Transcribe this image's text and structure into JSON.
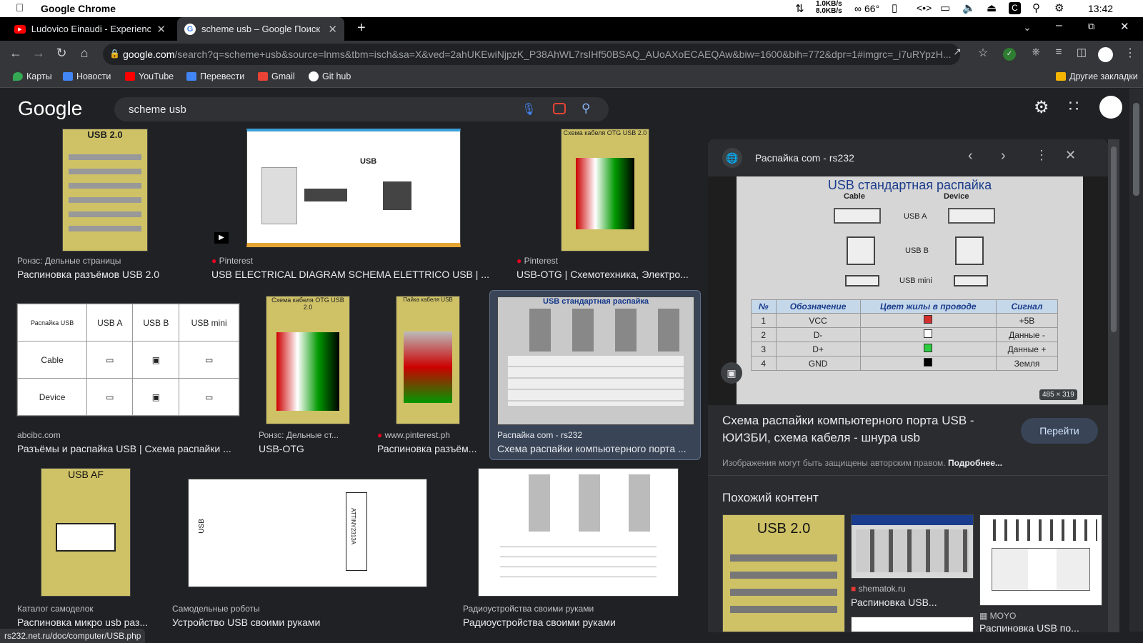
{
  "mac_menubar": {
    "app_name": "Google Chrome",
    "net_up": "1.0KB/s",
    "net_down": "8.0KB/s",
    "temperature": "66°",
    "time": "13:42"
  },
  "tabs": [
    {
      "title": "Ludovico Einaudi - Experience (Li",
      "favicon": "youtube-icon",
      "active": false
    },
    {
      "title": "scheme usb – Google Поиск",
      "favicon": "google-icon",
      "active": true
    }
  ],
  "address_bar": {
    "host": "google.com",
    "path": "/search?q=scheme+usb&source=lnms&tbm=isch&sa=X&ved=2ahUKEwiNjpzK_P38AhWL7rsIHf50BSAQ_AUoAXoECAEQAw&biw=1600&bih=772&dpr=1#imgrc=_i7uRYpzH..."
  },
  "bookmarks": [
    {
      "label": "Карты",
      "icon": "maps-icon",
      "color": "#34a853"
    },
    {
      "label": "Новости",
      "icon": "news-icon",
      "color": "#4285f4"
    },
    {
      "label": "YouTube",
      "icon": "youtube-icon",
      "color": "#ff0000"
    },
    {
      "label": "Перевести",
      "icon": "translate-icon",
      "color": "#4285f4"
    },
    {
      "label": "Gmail",
      "icon": "gmail-icon",
      "color": "#ea4335"
    },
    {
      "label": "Git hub",
      "icon": "github-icon",
      "color": "#ffffff"
    }
  ],
  "other_bookmarks": "Другие закладки",
  "google": {
    "logo": "Google",
    "query": "scheme usb"
  },
  "results": [
    {
      "source": "Ронзс: Дельные страницы",
      "title": "Распиновка разъёмов USB 2.0"
    },
    {
      "source": "Pinterest",
      "title": "USB ELECTRICAL DIAGRAM SCHEMA ELETTRICO USB | ..."
    },
    {
      "source": "Pinterest",
      "title": "USB-OTG | Схемотехника, Электро..."
    },
    {
      "source": "abcibc.com",
      "title": "Разъёмы и распайка USB | Схема распайки ..."
    },
    {
      "source": "Ронзс: Дельные ст...",
      "title": "USB-OTG"
    },
    {
      "source": "www.pinterest.ph",
      "title": "Распиновка разъём..."
    },
    {
      "source": "Распайка com - rs232",
      "title": "Схема распайки компьютерного порта ..."
    },
    {
      "source": "Каталог самоделок",
      "title": "Распиновка микро usb раз..."
    },
    {
      "source": "Самодельные роботы",
      "title": "Устройство USB своими руками"
    },
    {
      "source": "Радиоустройства своими руками",
      "title": "Радиоустройства своими руками"
    }
  ],
  "thumb_text": {
    "usb20": "USB 2.0",
    "otg_cable": "Схема кабеля OTG USB 2.0",
    "otg_pinout": "Пайка кабеля USB",
    "usb_af": "USB AF",
    "table_head": [
      "Распайка USB",
      "USB A",
      "USB B",
      "USB mini"
    ],
    "table_rows": [
      "Cable",
      "Device"
    ],
    "rs232_title": "USB стандартная распайка",
    "usb_label": "USB",
    "chip_label": "ATTINY2313A"
  },
  "panel": {
    "site": "Распайка com - rs232",
    "image_size": "485 × 319",
    "image_title": "USB стандартная распайка",
    "image_labels": {
      "cable": "Cable",
      "device": "Device",
      "usb_a": "USB A",
      "usb_b": "USB B",
      "usb_mini": "USB mini"
    },
    "table_headers": [
      "№",
      "Обозначение",
      "Цвет жилы в проводе",
      "Сигнал"
    ],
    "table_rows": [
      {
        "n": "1",
        "name": "VCC",
        "color": "#d32f2f",
        "signal": "+5В"
      },
      {
        "n": "2",
        "name": "D-",
        "color": "#ffffff",
        "signal": "Данные -"
      },
      {
        "n": "3",
        "name": "D+",
        "color": "#2ecc40",
        "signal": "Данные +"
      },
      {
        "n": "4",
        "name": "GND",
        "color": "#000000",
        "signal": "Земля"
      }
    ],
    "title": "Схема распайки компьютерного порта USB - ЮИЗБИ, схема кабеля - шнура usb",
    "visit_button": "Перейти",
    "copyright": "Изображения могут быть защищены авторским правом.",
    "more": "Подробнее...",
    "related_heading": "Похожий контент",
    "related": [
      {
        "source": "shematok.ru",
        "title": "Распиновка USB..."
      },
      {
        "source": "MOYO",
        "title": "Распиновка USB по..."
      }
    ]
  },
  "status_url": "rs232.net.ru/doc/computer/USB.php"
}
